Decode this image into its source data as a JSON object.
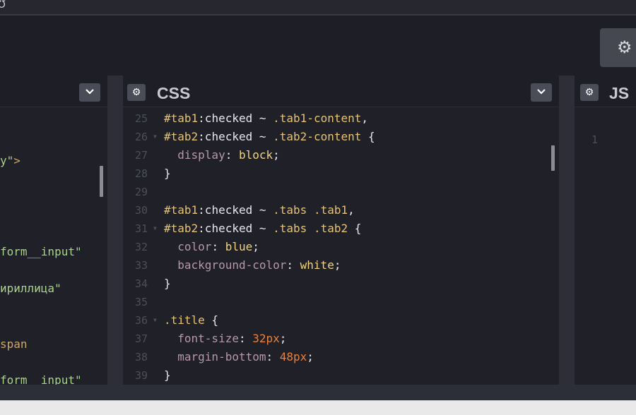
{
  "window": {
    "partial_glyph": "Ʊ"
  },
  "toolbar": {
    "settings_icon": "gear-icon",
    "settings_glyph": "⚙"
  },
  "html_panel": {
    "collapse_icon": "chevron-down-icon",
    "lines": [
      {
        "text": "",
        "y": 0
      },
      {
        "text": "y\">",
        "y": 0
      }
    ],
    "fragments": [
      {
        "text": "y\"",
        "kind": "str"
      },
      {
        "text": ">",
        "kind": "tag"
      },
      {
        "text": "form__input\"",
        "kind": "str"
      },
      {
        "text": "ириллица\"",
        "kind": "str"
      },
      {
        "text": "span",
        "kind": "tag"
      },
      {
        "text": "form__input\"",
        "kind": "str"
      }
    ]
  },
  "css_panel": {
    "title": "CSS",
    "settings_icon": "gear-icon",
    "settings_glyph": "⚙",
    "collapse_icon": "chevron-down-icon",
    "code_lines": [
      {
        "num": "25",
        "fold": "",
        "parts": [
          [
            "#tab1",
            "sel"
          ],
          [
            ":checked ~ ",
            "plain"
          ],
          [
            ".tab1-content",
            "sel"
          ],
          [
            ",",
            "plain"
          ]
        ]
      },
      {
        "num": "26",
        "fold": "▼",
        "parts": [
          [
            "#tab2",
            "sel"
          ],
          [
            ":checked ~ ",
            "plain"
          ],
          [
            ".tab2-content",
            "sel"
          ],
          [
            " {",
            "plain"
          ]
        ]
      },
      {
        "num": "27",
        "fold": "",
        "parts": [
          [
            "  display",
            "prop"
          ],
          [
            ": ",
            "plain"
          ],
          [
            "block",
            "kw"
          ],
          [
            ";",
            "plain"
          ]
        ]
      },
      {
        "num": "28",
        "fold": "",
        "parts": [
          [
            "}",
            "plain"
          ]
        ]
      },
      {
        "num": "29",
        "fold": "",
        "parts": []
      },
      {
        "num": "30",
        "fold": "",
        "parts": [
          [
            "#tab1",
            "sel"
          ],
          [
            ":checked ~ ",
            "plain"
          ],
          [
            ".tabs .tab1",
            "sel"
          ],
          [
            ",",
            "plain"
          ]
        ]
      },
      {
        "num": "31",
        "fold": "▼",
        "parts": [
          [
            "#tab2",
            "sel"
          ],
          [
            ":checked ~ ",
            "plain"
          ],
          [
            ".tabs .tab2",
            "sel"
          ],
          [
            " {",
            "plain"
          ]
        ]
      },
      {
        "num": "32",
        "fold": "",
        "parts": [
          [
            "  color",
            "prop"
          ],
          [
            ": ",
            "plain"
          ],
          [
            "blue",
            "kw"
          ],
          [
            ";",
            "plain"
          ]
        ]
      },
      {
        "num": "33",
        "fold": "",
        "parts": [
          [
            "  background-color",
            "prop"
          ],
          [
            ": ",
            "plain"
          ],
          [
            "white",
            "kw"
          ],
          [
            ";",
            "plain"
          ]
        ]
      },
      {
        "num": "34",
        "fold": "",
        "parts": [
          [
            "}",
            "plain"
          ]
        ]
      },
      {
        "num": "35",
        "fold": "",
        "parts": []
      },
      {
        "num": "36",
        "fold": "▼",
        "parts": [
          [
            ".title",
            "sel"
          ],
          [
            " {",
            "plain"
          ]
        ]
      },
      {
        "num": "37",
        "fold": "",
        "parts": [
          [
            "  font-size",
            "prop"
          ],
          [
            ": ",
            "plain"
          ],
          [
            "32px",
            "num"
          ],
          [
            ";",
            "plain"
          ]
        ]
      },
      {
        "num": "38",
        "fold": "",
        "parts": [
          [
            "  margin-bottom",
            "prop"
          ],
          [
            ": ",
            "plain"
          ],
          [
            "48px",
            "num"
          ],
          [
            ";",
            "plain"
          ]
        ]
      },
      {
        "num": "39",
        "fold": "",
        "parts": [
          [
            "}",
            "plain"
          ]
        ]
      }
    ]
  },
  "js_panel": {
    "title": "JS",
    "settings_icon": "gear-icon",
    "settings_glyph": "⚙",
    "line_numbers": [
      "1"
    ]
  }
}
